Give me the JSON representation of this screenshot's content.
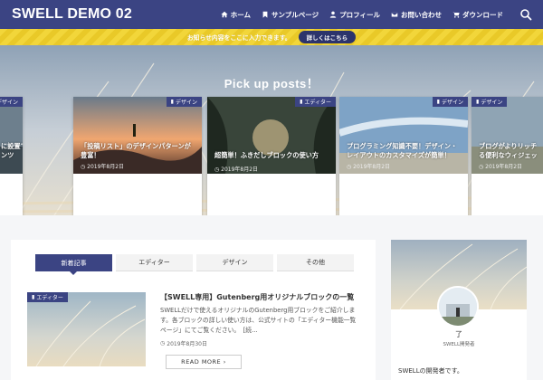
{
  "header": {
    "logo": "SWELL DEMO 02",
    "nav": [
      {
        "label": "ホーム",
        "icon": "home-icon"
      },
      {
        "label": "サンプルページ",
        "icon": "bookmark-icon"
      },
      {
        "label": "プロフィール",
        "icon": "person-icon"
      },
      {
        "label": "お問い合わせ",
        "icon": "mail-icon"
      },
      {
        "label": "ダウンロード",
        "icon": "cart-icon"
      }
    ],
    "search_icon": "search-icon"
  },
  "notice": {
    "text": "お知らせ内容をここに入力できます。",
    "button": "詳しくはこちら"
  },
  "hero": {
    "title": "Pick up posts！",
    "cards": [
      {
        "tag": "デザイン",
        "title": "に設置できる！目\nンツ",
        "date": ""
      },
      {
        "tag": "デザイン",
        "title": "「投稿リスト」のデザインパターンが豊富！",
        "date": "2019年8月2日"
      },
      {
        "tag": "エディター",
        "title": "超簡単！ふきだしブロックの使い方",
        "date": "2019年8月2日"
      },
      {
        "tag": "デザイン",
        "title": "プログラミング知識不要！デザイン・レイアウトのカスタマイズが簡単！",
        "date": "2019年8月2日"
      },
      {
        "tag": "デザイン",
        "title": "ブログがよりリッチ\nる便利なウィジェッ",
        "date": "2019年8月2日"
      }
    ],
    "dots_count": 8,
    "active_dot": 6
  },
  "main": {
    "tabs": [
      "新着記事",
      "エディター",
      "デザイン",
      "その他"
    ],
    "post": {
      "tag": "エディター",
      "title": "【SWELL専用】Gutenberg用オリジナルブロックの一覧",
      "excerpt": "SWELLだけで使えるオリジナルのGutenberg用ブロックをご紹介します。各ブロックの詳しい使い方は、公式サイトの「エディター機能一覧ページ」にてご覧ください。　[続...",
      "date": "2019年8月30日",
      "readmore": "READ MORE ›"
    }
  },
  "sidebar": {
    "name": "了",
    "role": "SWELL開発者",
    "bio": "SWELLの開発者です。"
  },
  "colors": {
    "brand": "#3b4483",
    "notice": "#f2d63a"
  }
}
